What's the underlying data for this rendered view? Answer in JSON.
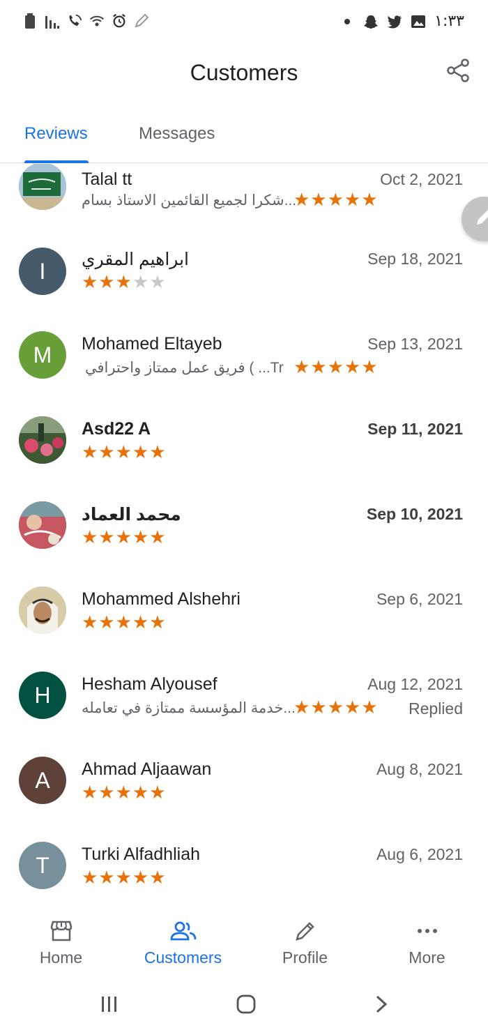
{
  "status_bar": {
    "time": "١:٣٣",
    "left_icons": [
      "battery-icon",
      "signal-icon",
      "wifi-call-icon",
      "wifi-icon",
      "alarm-icon",
      "edit-pen-icon"
    ],
    "right_icons": [
      "dot-icon",
      "snapchat-icon",
      "twitter-icon",
      "gallery-icon"
    ]
  },
  "header": {
    "title": "Customers",
    "share_icon": "share-icon"
  },
  "tabs": [
    {
      "label": "Reviews",
      "active": true
    },
    {
      "label": "Messages",
      "active": false
    }
  ],
  "reviews": [
    {
      "name": "Talal tt",
      "date": "Oct 2, 2021",
      "rating": 5,
      "snippet": "شكرا لجميع القائمين الاستاذ بسام...",
      "avatar_letter": "",
      "avatar_color": "#5a8f4a",
      "bold": false,
      "replied": ""
    },
    {
      "name": "ابراهيم المقري",
      "date": "Sep 18, 2021",
      "rating": 3,
      "snippet": "",
      "avatar_letter": "I",
      "avatar_color": "#455a6b",
      "bold": false,
      "replied": ""
    },
    {
      "name": "Mohamed Eltayeb",
      "date": "Sep 13, 2021",
      "rating": 5,
      "snippet": "فريق عمل ممتاز واحترافي ( ...Tr",
      "avatar_letter": "M",
      "avatar_color": "#689f38",
      "bold": false,
      "replied": ""
    },
    {
      "name": "Asd22 A",
      "date": "Sep 11, 2021",
      "rating": 5,
      "snippet": "",
      "avatar_letter": "",
      "avatar_color": "#4a6b3a",
      "bold": true,
      "replied": ""
    },
    {
      "name": "محمد العماد",
      "date": "Sep 10, 2021",
      "rating": 5,
      "snippet": "",
      "avatar_letter": "",
      "avatar_color": "#b5484e",
      "bold": true,
      "replied": ""
    },
    {
      "name": "Mohammed Alshehri",
      "date": "Sep 6, 2021",
      "rating": 5,
      "snippet": "",
      "avatar_letter": "",
      "avatar_color": "#c9b89a",
      "bold": false,
      "replied": ""
    },
    {
      "name": "Hesham Alyousef",
      "date": "Aug 12, 2021",
      "rating": 5,
      "snippet": "خدمة المؤسسة ممتازة في تعامله...",
      "avatar_letter": "H",
      "avatar_color": "#00513f",
      "bold": false,
      "replied": "Replied"
    },
    {
      "name": "Ahmad Aljaawan",
      "date": "Aug 8, 2021",
      "rating": 5,
      "snippet": "",
      "avatar_letter": "A",
      "avatar_color": "#5d4037",
      "bold": false,
      "replied": ""
    },
    {
      "name": "Turki Alfadhliah",
      "date": "Aug 6, 2021",
      "rating": 5,
      "snippet": "",
      "avatar_letter": "T",
      "avatar_color": "#78909c",
      "bold": false,
      "replied": ""
    }
  ],
  "fab_icon": "pencil-icon",
  "bottom_nav": [
    {
      "label": "Home",
      "icon": "store-icon",
      "active": false
    },
    {
      "label": "Customers",
      "icon": "people-icon",
      "active": true
    },
    {
      "label": "Profile",
      "icon": "pencil-icon",
      "active": false
    },
    {
      "label": "More",
      "icon": "more-dots-icon",
      "active": false
    }
  ],
  "system_nav": [
    "recents-icon",
    "home-circle-icon",
    "back-icon"
  ],
  "colors": {
    "accent": "#1a73e8",
    "star": "#e8710a",
    "star_empty": "#c8c8c8",
    "text_secondary": "#5f6368"
  }
}
